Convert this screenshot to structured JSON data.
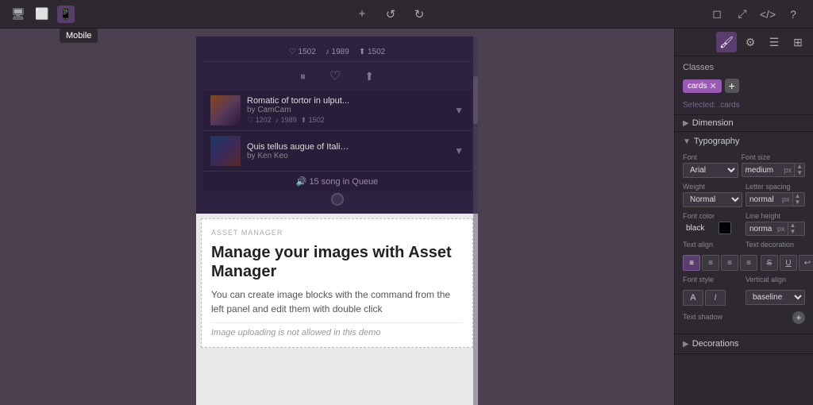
{
  "toolbar": {
    "devices": [
      {
        "id": "desktop",
        "icon": "🖥",
        "label": "Desktop"
      },
      {
        "id": "tablet",
        "icon": "⬜",
        "label": "Tablet"
      },
      {
        "id": "mobile",
        "icon": "📱",
        "label": "Mobile",
        "active": true
      }
    ],
    "mobile_tooltip": "Mobile",
    "add_icon": "+",
    "undo_icon": "↺",
    "redo_icon": "↻",
    "panel_icons": [
      "◻",
      "⤢",
      "</>",
      "?"
    ]
  },
  "canvas": {
    "phone": {
      "top_stats": [
        {
          "icon": "♡",
          "value": "1502"
        },
        {
          "icon": "♪",
          "value": "1989"
        },
        {
          "icon": "⬆",
          "value": "1502"
        }
      ],
      "controls": [
        "⏸",
        "♡",
        "⬆"
      ],
      "songs": [
        {
          "title": "Romatic of tortor in ulput...",
          "artist": "by CamCam",
          "stats": [
            "♡ 1202",
            "♪ 1989",
            "⬆ 1502"
          ]
        },
        {
          "title": "Quis tellus augue of Italia...",
          "artist": "by Ken Keo",
          "stats": []
        }
      ],
      "queue_text": "🔊 15 song in Queue"
    },
    "asset_manager": {
      "label": "ASSET MANAGER",
      "title": "Manage your images with Asset Manager",
      "description": "You can create image blocks with the command from the left panel and edit them with double click",
      "note": "Image uploading is not allowed in this demo"
    }
  },
  "right_panel": {
    "classes_label": "Classes",
    "class_tag": "cards",
    "selected_label": "Selected: .cards",
    "dimension_label": "Dimension",
    "typography_label": "Typography",
    "font_label": "Font",
    "font_value": "Arial",
    "font_size_label": "Font size",
    "font_size_value": "medium",
    "font_size_unit": "px",
    "weight_label": "Weight",
    "weight_value": "Normal",
    "letter_spacing_label": "Letter spacing",
    "letter_spacing_value": "normal",
    "letter_spacing_unit": "px",
    "font_color_label": "Font color",
    "font_color_value": "black",
    "line_height_label": "Line height",
    "line_height_value": "normal",
    "line_height_unit": "px",
    "text_align_label": "Text align",
    "text_decoration_label": "Text decoration",
    "font_style_label": "Font style",
    "vertical_align_label": "Vertical align",
    "vertical_align_value": "baseline",
    "text_shadow_label": "Text shadow",
    "decorations_label": "Decorations"
  }
}
